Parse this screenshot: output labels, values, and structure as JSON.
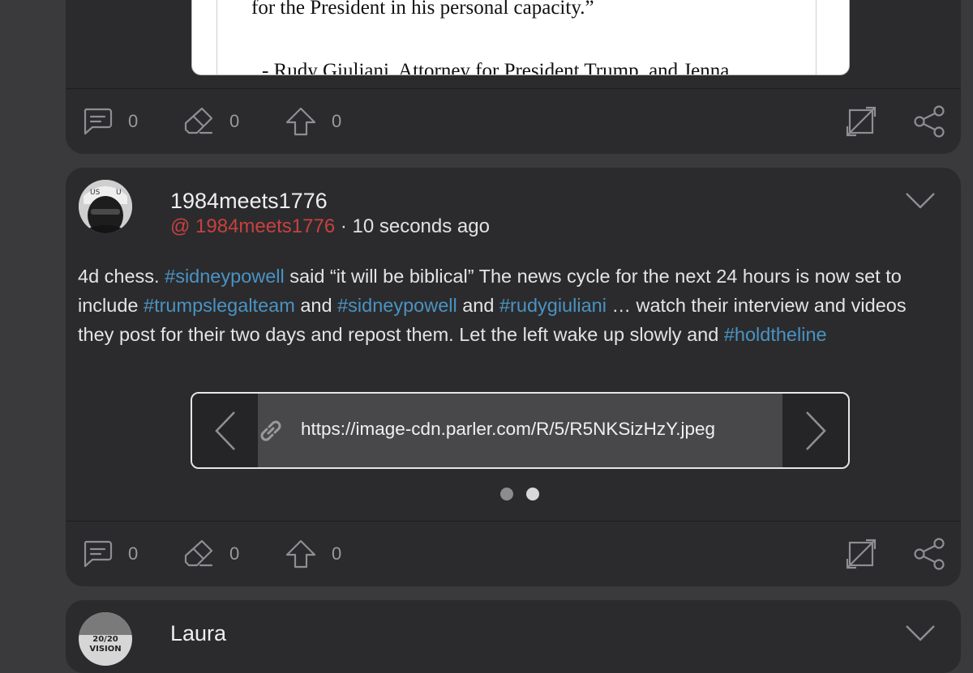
{
  "post_previous": {
    "embed_lines": [
      "for the President in his personal capacity.”",
      "- Rudy Giuliani, Attorney for President Trump, and Jenna"
    ],
    "actions": {
      "comments": "0",
      "echoes": "0",
      "upvotes": "0"
    },
    "icons": [
      "comment-icon",
      "echo-icon",
      "upvote-icon",
      "expand-icon",
      "share-icon"
    ]
  },
  "post": {
    "display_name": "1984meets1776",
    "handle": "@ 1984meets1776",
    "separator": " · ",
    "timestamp": "10 seconds ago",
    "body": [
      {
        "t": "text",
        "v": "4d chess. "
      },
      {
        "t": "tag",
        "v": "#sidneypowell"
      },
      {
        "t": "text",
        "v": " said “it will be biblical” The news cycle for the next 24 hours is now set to include "
      },
      {
        "t": "tag",
        "v": "#trumpslegalteam"
      },
      {
        "t": "text",
        "v": " and "
      },
      {
        "t": "tag",
        "v": "#sidneypowell"
      },
      {
        "t": "text",
        "v": " and "
      },
      {
        "t": "tag",
        "v": "#rudygiuliani"
      },
      {
        "t": "text",
        "v": " … watch their interview and videos they post for their two days and repost them. Let the left wake up slowly and "
      },
      {
        "t": "tag",
        "v": "#holdtheline"
      }
    ],
    "link_url": "https://image-cdn.parler.com/R/5/R5NKSizHzY.jpeg",
    "carousel_pages": 2,
    "carousel_active": 2,
    "actions": {
      "comments": "0",
      "echoes": "0",
      "upvotes": "0"
    }
  },
  "post_next": {
    "display_name": "Laura",
    "avatar_text": [
      "20/20",
      "VISION"
    ]
  },
  "colors": {
    "background": "#3a3a3c",
    "card": "#2b2b2d",
    "handle": "#c8413f",
    "hashtag": "#4a93c3",
    "icon": "#8e8e93"
  }
}
